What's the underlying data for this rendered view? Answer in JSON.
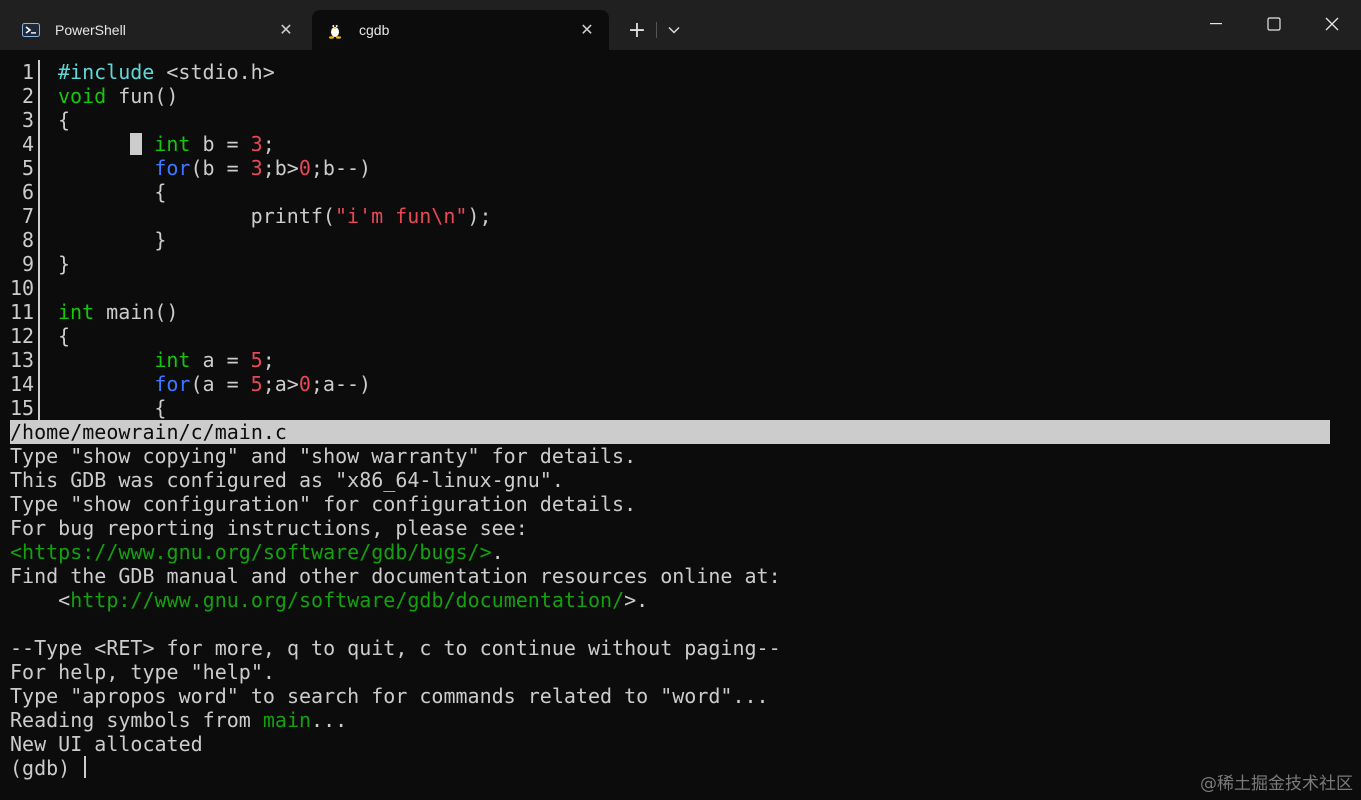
{
  "tabs": [
    {
      "label": "PowerShell",
      "icon": "powershell-icon",
      "active": false
    },
    {
      "label": "cgdb",
      "icon": "linux-penguin-icon",
      "active": true
    }
  ],
  "source": {
    "lines": [
      {
        "n": "1",
        "segs": [
          [
            "pp",
            "#include"
          ],
          [
            "",
            " <stdio.h>"
          ]
        ]
      },
      {
        "n": "2",
        "segs": [
          [
            "ty",
            "void"
          ],
          [
            "",
            " fun()"
          ]
        ]
      },
      {
        "n": "3",
        "segs": [
          [
            "",
            "{"
          ]
        ]
      },
      {
        "n": "4",
        "segs": [
          [
            "",
            "        "
          ],
          [
            "ty",
            "int"
          ],
          [
            "",
            " b = "
          ],
          [
            "num",
            "3"
          ],
          [
            "",
            ";"
          ]
        ],
        "cursor": true
      },
      {
        "n": "5",
        "segs": [
          [
            "",
            "        "
          ],
          [
            "kw",
            "for"
          ],
          [
            "",
            "(b = "
          ],
          [
            "num",
            "3"
          ],
          [
            "",
            ";b>"
          ],
          [
            "num",
            "0"
          ],
          [
            "",
            ";b--)"
          ]
        ]
      },
      {
        "n": "6",
        "segs": [
          [
            "",
            "        {"
          ]
        ]
      },
      {
        "n": "7",
        "segs": [
          [
            "",
            "                printf("
          ],
          [
            "str",
            "\"i'm fun\\n\""
          ],
          [
            "",
            ");"
          ]
        ]
      },
      {
        "n": "8",
        "segs": [
          [
            "",
            "        }"
          ]
        ]
      },
      {
        "n": "9",
        "segs": [
          [
            "",
            "}"
          ]
        ]
      },
      {
        "n": "10",
        "segs": []
      },
      {
        "n": "11",
        "segs": [
          [
            "ty",
            "int"
          ],
          [
            "",
            " main()"
          ]
        ]
      },
      {
        "n": "12",
        "segs": [
          [
            "",
            "{"
          ]
        ]
      },
      {
        "n": "13",
        "segs": [
          [
            "",
            "        "
          ],
          [
            "ty",
            "int"
          ],
          [
            "",
            " a = "
          ],
          [
            "num",
            "5"
          ],
          [
            "",
            ";"
          ]
        ]
      },
      {
        "n": "14",
        "segs": [
          [
            "",
            "        "
          ],
          [
            "kw",
            "for"
          ],
          [
            "",
            "(a = "
          ],
          [
            "num",
            "5"
          ],
          [
            "",
            ";a>"
          ],
          [
            "num",
            "0"
          ],
          [
            "",
            ";a--)"
          ]
        ]
      },
      {
        "n": "15",
        "segs": [
          [
            "",
            "        {"
          ]
        ]
      }
    ]
  },
  "status_bar": {
    "file_path": "/home/meowrain/c/main.c"
  },
  "gdb_output": [
    [
      [
        "",
        "Type \"show copying\" and \"show warranty\" for details."
      ]
    ],
    [
      [
        "",
        "This GDB was configured as \"x86_64-linux-gnu\"."
      ]
    ],
    [
      [
        "",
        "Type \"show configuration\" for configuration details."
      ]
    ],
    [
      [
        "",
        "For bug reporting instructions, please see:"
      ]
    ],
    [
      [
        "grn",
        "<https://www.gnu.org/software/gdb/bugs/>"
      ],
      [
        "",
        "."
      ]
    ],
    [
      [
        "",
        "Find the GDB manual and other documentation resources online at:"
      ]
    ],
    [
      [
        "",
        "    <"
      ],
      [
        "grn",
        "http://www.gnu.org/software/gdb/documentation/"
      ],
      [
        "",
        ">."
      ]
    ],
    [
      [
        "",
        ""
      ]
    ],
    [
      [
        "",
        "--Type <RET> for more, q to quit, c to continue without paging--"
      ]
    ],
    [
      [
        "",
        "For help, type \"help\"."
      ]
    ],
    [
      [
        "",
        "Type \"apropos word\" to search for commands related to \"word\"..."
      ]
    ],
    [
      [
        "",
        "Reading symbols from "
      ],
      [
        "grn",
        "main"
      ],
      [
        "",
        "..."
      ]
    ],
    [
      [
        "",
        "New UI allocated"
      ]
    ]
  ],
  "prompt": "(gdb) ",
  "watermark": "@稀土掘金技术社区"
}
